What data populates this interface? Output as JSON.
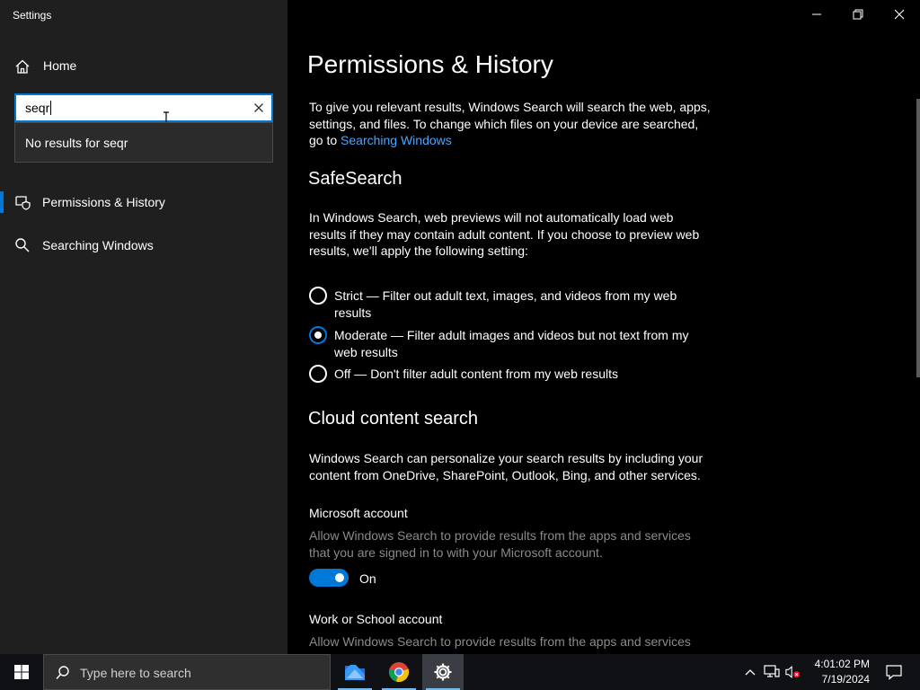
{
  "window": {
    "title": "Settings",
    "minimize_icon": "minimize-icon",
    "restore_icon": "restore-icon",
    "close_icon": "close-icon"
  },
  "sidebar": {
    "home_label": "Home",
    "search": {
      "value": "seqr",
      "clear_icon": "clear-icon"
    },
    "suggestion": "No results for seqr",
    "items": [
      {
        "label": "Permissions & History",
        "icon": "shield-icon",
        "active": true
      },
      {
        "label": "Searching Windows",
        "icon": "search-icon",
        "active": false
      }
    ]
  },
  "main": {
    "title": "Permissions & History",
    "intro_text": "To give you relevant results, Windows Search will search the web, apps, settings, and files. To change which files on your device are searched, go to ",
    "intro_link": "Searching Windows",
    "safesearch": {
      "heading": "SafeSearch",
      "description": "In Windows Search, web previews will not automatically load web results if they may contain adult content. If you choose to preview web results, we'll apply the following setting:",
      "options": [
        {
          "label": "Strict — Filter out adult text, images, and videos from my web results",
          "selected": false
        },
        {
          "label": "Moderate — Filter adult images and videos but not text from my web results",
          "selected": true
        },
        {
          "label": "Off — Don't filter adult content from my web results",
          "selected": false
        }
      ]
    },
    "cloud": {
      "heading": "Cloud content search",
      "description": "Windows Search can personalize your search results by including your content from OneDrive, SharePoint, Outlook, Bing, and other services.",
      "microsoft": {
        "title": "Microsoft account",
        "description": "Allow Windows Search to provide results from the apps and services that you are signed in to with your Microsoft account.",
        "toggle_state": "On"
      },
      "work": {
        "title": "Work or School account",
        "description": "Allow Windows Search to provide results from the apps and services"
      }
    }
  },
  "taskbar": {
    "search_placeholder": "Type here to search",
    "apps": [
      "file-explorer-icon",
      "chrome-icon",
      "settings-icon"
    ],
    "time": "4:01:02 PM",
    "date": "7/19/2024"
  },
  "colors": {
    "accent": "#0078d7",
    "link": "#4aa6ff",
    "sidebar_bg": "#1f1f1f"
  }
}
